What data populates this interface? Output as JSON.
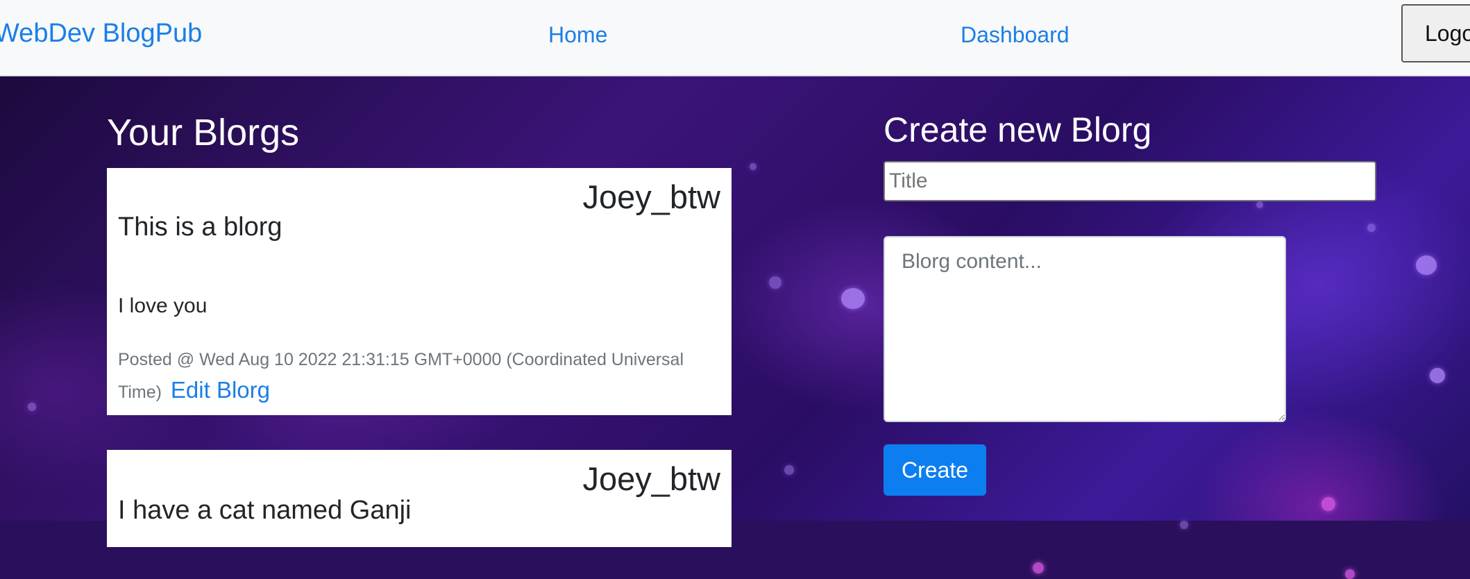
{
  "navbar": {
    "brand": "WebDev BlogPub",
    "links": [
      {
        "label": "Home"
      },
      {
        "label": "Dashboard"
      }
    ],
    "logout_label": "Logout"
  },
  "blogs_section": {
    "title": "Your Blorgs",
    "posts": [
      {
        "author": "Joey_btw",
        "title": "This is a blorg",
        "content": "I love you",
        "posted": "Posted @ Wed Aug 10 2022 21:31:15 GMT+0000 (Coordinated Universal Time)",
        "edit_label": "Edit Blorg"
      },
      {
        "author": "Joey_btw",
        "title": "I have a cat named Ganji"
      }
    ]
  },
  "create_form": {
    "heading": "Create new Blorg",
    "title_placeholder": "Title",
    "content_placeholder": "Blorg content...",
    "submit_label": "Create"
  },
  "colors": {
    "link": "#1a7fe6",
    "primary_button": "#0d7ef0",
    "navbar_bg": "#f8f9fa"
  }
}
